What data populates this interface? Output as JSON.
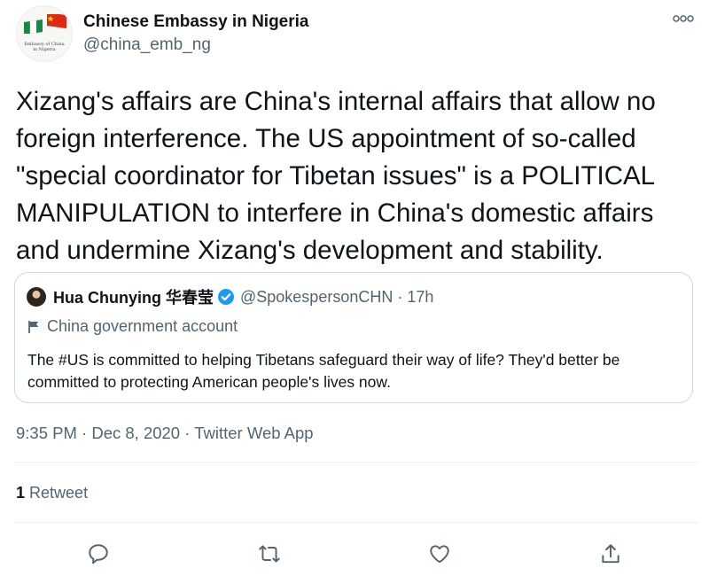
{
  "author": {
    "display_name": "Chinese Embassy in Nigeria",
    "handle": "@china_emb_ng",
    "avatar_text": "Embassy of China in Nigeria",
    "avatar_icon": "nigeria-china-flags-icon"
  },
  "tweet": {
    "text": "Xizang's affairs are China's internal affairs that allow no foreign interference. The US appointment of so-called \"special coordinator for Tibetan issues\" is a POLITICAL MANIPULATION to interfere in China's domestic affairs and undermine Xizang's development and stability.",
    "timestamp": "9:35 PM · Dec 8, 2020 · Twitter Web App"
  },
  "quoted_tweet": {
    "display_name": "Hua Chunying 华春莹",
    "handle_time": "@SpokespersonCHN · 17h",
    "account_label": "China government account",
    "text": "The #US is committed to helping Tibetans safeguard their way of life? They'd better be committed to protecting American people's lives now."
  },
  "stats": {
    "retweet_count": "1",
    "retweet_label": "Retweet"
  },
  "icons": {
    "more": "more-options-icon",
    "reply": "reply-icon",
    "retweet": "retweet-icon",
    "like": "like-icon",
    "share": "share-icon",
    "verified": "verified-badge-icon",
    "flag": "flag-icon"
  },
  "colors": {
    "text_primary": "#0f1419",
    "text_secondary": "#536471",
    "border": "#cfd9de",
    "verified_blue": "#1d9bf0",
    "divider": "#eff3f4"
  }
}
